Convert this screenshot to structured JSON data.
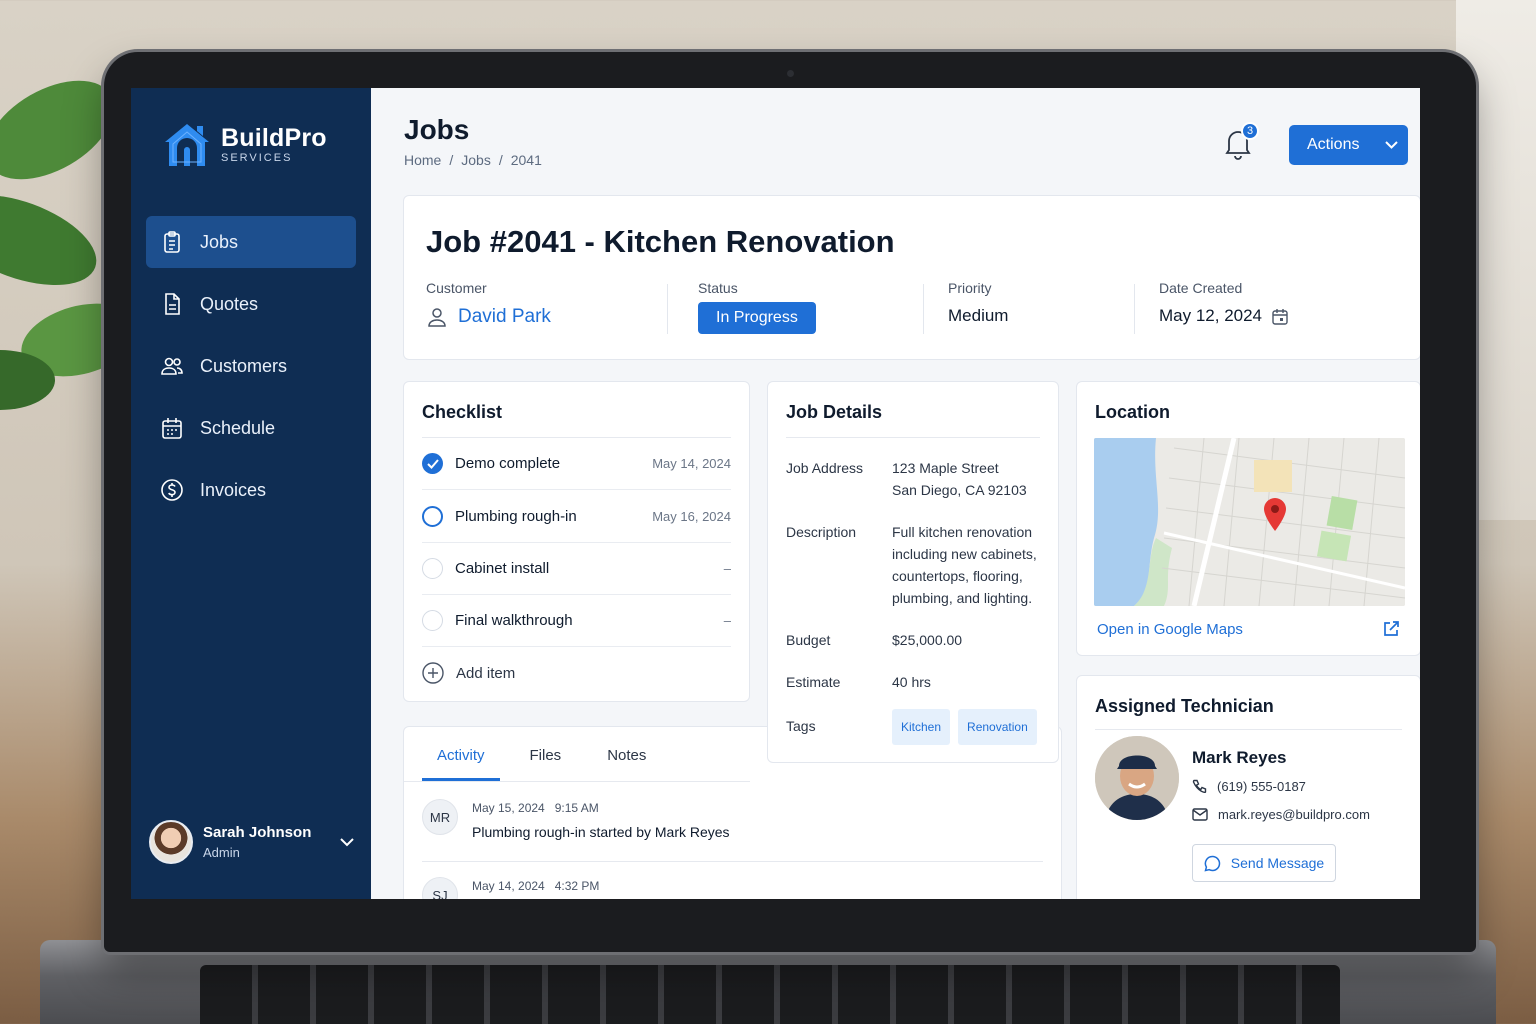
{
  "brand": {
    "name": "BuildPro",
    "sub": "SERVICES"
  },
  "sidebar": {
    "items": [
      {
        "label": "Jobs",
        "icon": "clipboard-icon",
        "active": true
      },
      {
        "label": "Quotes",
        "icon": "document-icon"
      },
      {
        "label": "Customers",
        "icon": "users-icon"
      },
      {
        "label": "Schedule",
        "icon": "calendar-icon"
      },
      {
        "label": "Invoices",
        "icon": "dollar-icon"
      }
    ]
  },
  "user": {
    "name": "Sarah Johnson",
    "role": "Admin"
  },
  "header": {
    "title": "Jobs",
    "breadcrumb": [
      "Home",
      "Jobs",
      "2041"
    ],
    "notification_count": "3",
    "actions_label": "Actions"
  },
  "job": {
    "title": "Job #2041 - Kitchen Renovation",
    "customer_label": "Customer",
    "customer": "David Park",
    "status_label": "Status",
    "status": "In Progress",
    "priority_label": "Priority",
    "priority": "Medium",
    "date_label": "Date Created",
    "date": "May 12, 2024"
  },
  "checklist": {
    "title": "Checklist",
    "items": [
      {
        "label": "Demo complete",
        "date": "May 14, 2024",
        "state": "done"
      },
      {
        "label": "Plumbing rough-in",
        "date": "May 16, 2024",
        "state": "current"
      },
      {
        "label": "Cabinet install",
        "date": "–",
        "state": "todo"
      },
      {
        "label": "Final walkthrough",
        "date": "–",
        "state": "todo"
      }
    ],
    "add_label": "Add item"
  },
  "activity": {
    "tabs": [
      "Activity",
      "Files",
      "Notes"
    ],
    "entries": [
      {
        "initials": "MR",
        "date": "May 15, 2024",
        "time": "9:15 AM",
        "text": "Plumbing rough-in started by Mark Reyes"
      },
      {
        "initials": "SJ",
        "date": "May 14, 2024",
        "time": "4:32 PM",
        "text": ""
      }
    ]
  },
  "details": {
    "title": "Job Details",
    "address_label": "Job Address",
    "address_line1": "123 Maple Street",
    "address_line2": "San Diego, CA 92103",
    "description_label": "Description",
    "description": "Full kitchen renovation including new cabinets, countertops, flooring, plumbing, and lighting.",
    "budget_label": "Budget",
    "budget": "$25,000.00",
    "estimate_label": "Estimate",
    "estimate": "40 hrs",
    "tags_label": "Tags",
    "tags": [
      "Kitchen",
      "Renovation"
    ]
  },
  "location": {
    "title": "Location",
    "link": "Open in Google Maps"
  },
  "technician": {
    "title": "Assigned Technician",
    "name": "Mark Reyes",
    "phone": "(619) 555-0187",
    "email": "mark.reyes@buildpro.com",
    "send_label": "Send Message"
  },
  "colors": {
    "accent": "#1f6fd6",
    "sidebar": "#0f2d53",
    "sidebar_active": "#1d4f8e"
  }
}
